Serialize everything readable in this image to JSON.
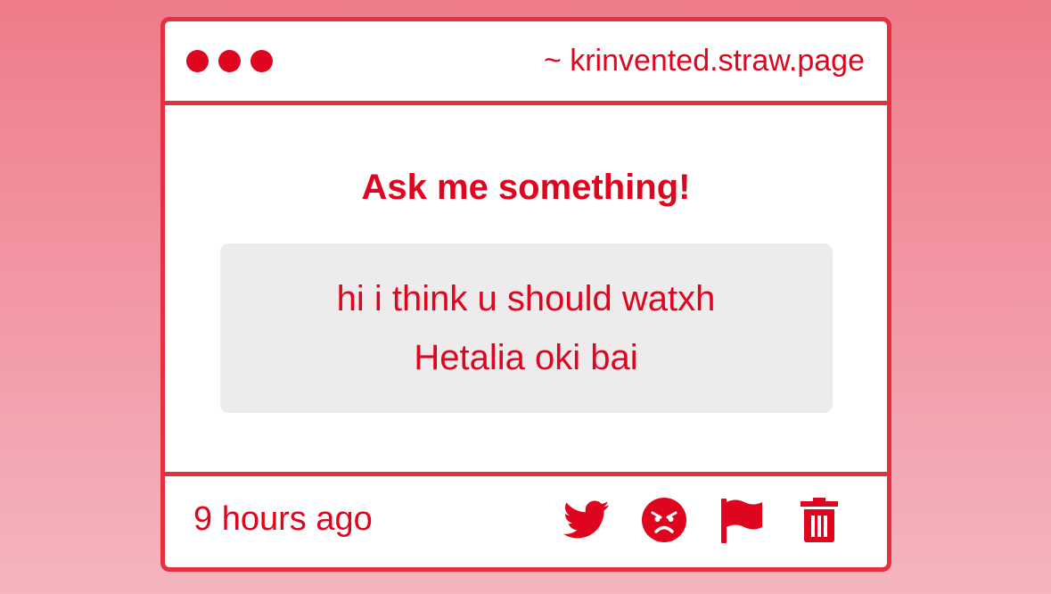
{
  "colors": {
    "accent": "#e0051f",
    "border": "#e4303f",
    "question_bg": "#edebec",
    "background_top": "#ef7b8a",
    "background_bottom": "#f4b5bf"
  },
  "titlebar": {
    "url": "~ krinvented.straw.page",
    "icons": [
      "window-dot-icon",
      "window-dot-icon",
      "window-dot-icon"
    ]
  },
  "main": {
    "heading": "Ask me something!",
    "question_lines": [
      "hi i think u should watxh",
      "Hetalia oki bai"
    ]
  },
  "footer": {
    "timestamp": "9 hours ago",
    "actions": [
      "twitter-icon",
      "angry-face-icon",
      "flag-icon",
      "trash-icon"
    ]
  }
}
